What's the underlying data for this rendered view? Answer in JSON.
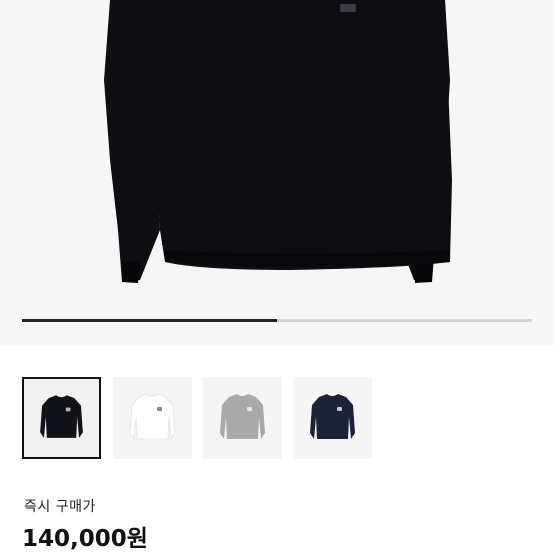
{
  "product": {
    "purchase_label": "즉시 구매가",
    "price": "140,000원"
  },
  "gallery": {
    "image_count": 4,
    "selected_index": 0,
    "scroll_progress": 0.5,
    "thumbnails": [
      {
        "color_name": "black",
        "color": "#111118"
      },
      {
        "color_name": "white",
        "color": "#f7f7f7"
      },
      {
        "color_name": "grey",
        "color": "#a9a9a9"
      },
      {
        "color_name": "navy",
        "color": "#1c2238"
      }
    ]
  },
  "colors": {
    "hero_background": "#f6f6f6",
    "sweater_black": "#0d0d12"
  }
}
